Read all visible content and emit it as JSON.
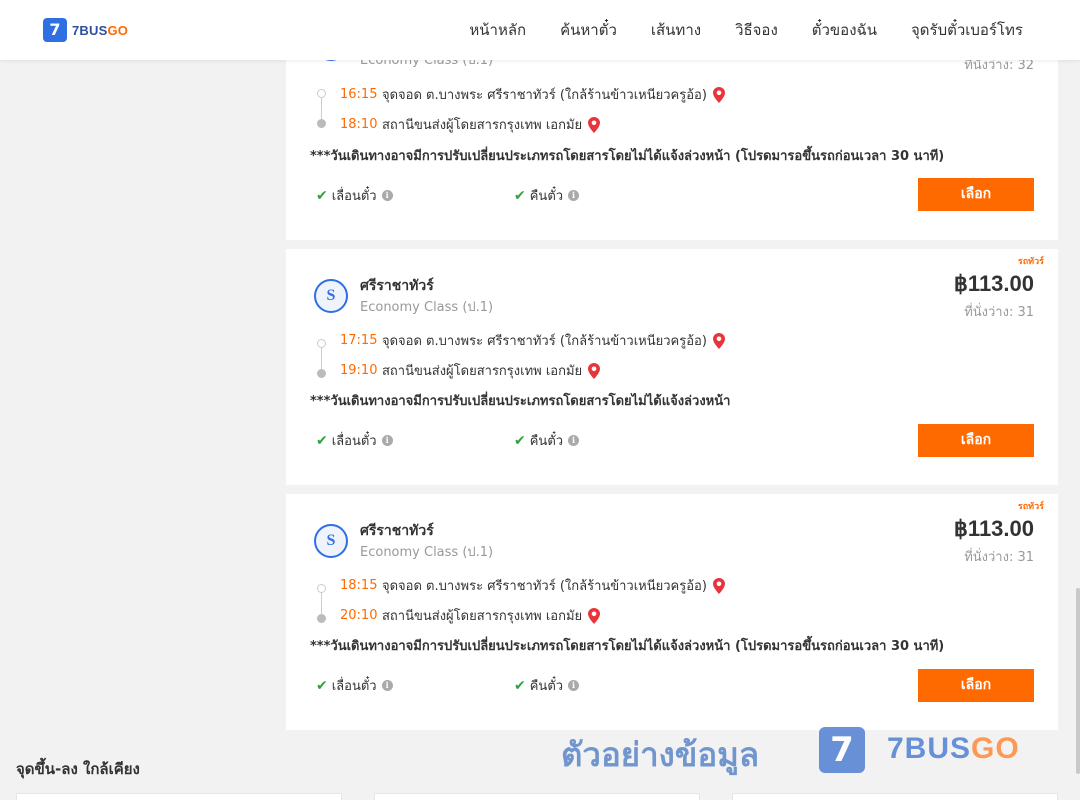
{
  "header": {
    "logo_mark": "7",
    "logo_text_main": "7BUS",
    "logo_text_accent": "GO",
    "nav": [
      "หน้าหลัก",
      "ค้นหาตั๋ว",
      "เส้นทาง",
      "วิธีจอง",
      "ตั๋วของฉัน",
      "จุดรับตั๋วเบอร์โทร"
    ]
  },
  "cards": [
    {
      "badge": "",
      "operator": "",
      "class": "Economy Class (ป.1)",
      "price": "",
      "seats": "ที่นั่งว่าง: 32",
      "departure_time": "16:15",
      "departure_place": "จุดจอด ต.บางพระ ศรีราชาทัวร์ (ใกล้ร้านข้าวเหนียวครูอ้อ)",
      "arrival_time": "18:10",
      "arrival_place": "สถานีขนส่งผู้โดยสารกรุงเทพ เอกมัย",
      "note": "***วันเดินทางอาจมีการปรับเปลี่ยนประเภทรถโดยสารโดยไม่ได้แจ้งล่วงหน้า (โปรดมารอขึ้นรถก่อนเวลา 30 นาที)",
      "option_reschedule": "เลื่อนตั๋ว",
      "option_refund": "คืนตั๋ว",
      "button": "เลือก"
    },
    {
      "badge": "รถทัวร์",
      "operator": "ศรีราชาทัวร์",
      "class": "Economy Class (ป.1)",
      "price": "฿113.00",
      "seats": "ที่นั่งว่าง: 31",
      "departure_time": "17:15",
      "departure_place": "จุดจอด ต.บางพระ ศรีราชาทัวร์ (ใกล้ร้านข้าวเหนียวครูอ้อ)",
      "arrival_time": "19:10",
      "arrival_place": "สถานีขนส่งผู้โดยสารกรุงเทพ เอกมัย",
      "note": "***วันเดินทางอาจมีการปรับเปลี่ยนประเภทรถโดยสารโดยไม่ได้แจ้งล่วงหน้า",
      "option_reschedule": "เลื่อนตั๋ว",
      "option_refund": "คืนตั๋ว",
      "button": "เลือก"
    },
    {
      "badge": "รถทัวร์",
      "operator": "ศรีราชาทัวร์",
      "class": "Economy Class (ป.1)",
      "price": "฿113.00",
      "seats": "ที่นั่งว่าง: 31",
      "departure_time": "18:15",
      "departure_place": "จุดจอด ต.บางพระ ศรีราชาทัวร์ (ใกล้ร้านข้าวเหนียวครูอ้อ)",
      "arrival_time": "20:10",
      "arrival_place": "สถานีขนส่งผู้โดยสารกรุงเทพ เอกมัย",
      "note": "***วันเดินทางอาจมีการปรับเปลี่ยนประเภทรถโดยสารโดยไม่ได้แจ้งล่วงหน้า (โปรดมารอขึ้นรถก่อนเวลา 30 นาที)",
      "option_reschedule": "เลื่อนตั๋ว",
      "option_refund": "คืนตั๋ว",
      "button": "เลือก"
    }
  ],
  "nearby": {
    "title": "จุดขึ้น-ลง ใกล้เคียง"
  },
  "watermark": {
    "text": "ตัวอย่างข้อมูล",
    "logo_mark": "7",
    "brand_main": "7BUS",
    "brand_accent": "GO"
  },
  "colors": {
    "accent": "#ff6a00",
    "brand_blue": "#2f6fe4",
    "check_green": "#2fa33a"
  },
  "icons": {
    "check": "check-icon",
    "info": "info-icon",
    "pin": "map-pin-icon"
  }
}
